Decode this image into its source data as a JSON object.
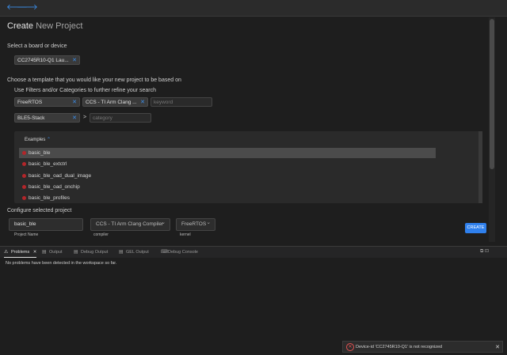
{
  "nav": {
    "back_icon": "arrow-left-icon",
    "forward_icon": "arrow-right-icon",
    "back_glyph": "🡐",
    "forward_glyph": "🡒"
  },
  "page": {
    "title_main": "Create",
    "title_rest": "New Project"
  },
  "board": {
    "section_label": "Select a board or device",
    "selected": "CC2745R10-Q1 Lau...",
    "remove_glyph": "✕"
  },
  "template": {
    "section_label": "Choose a template that you would like your new project to be based on",
    "filter_hint": "Use Filters and/or Categories to further refine your search",
    "filters": [
      "FreeRTOS",
      "CCS - TI Arm Clang ..."
    ],
    "keyword_placeholder": "keyword",
    "category_chip": "BLE5-Stack",
    "breadcrumb_sep": ">",
    "category_placeholder": "category"
  },
  "examples": {
    "header": "Examples",
    "header_caret": "⌃",
    "items": [
      "basic_ble",
      "basic_ble_extctrl",
      "basic_ble_oad_dual_image",
      "basic_ble_oad_onchip",
      "basic_ble_profiles"
    ],
    "selected_index": 0
  },
  "configure": {
    "section_label": "Configure selected project",
    "project_name": "basic_ble",
    "project_name_label": "Project Name",
    "compiler": "CCS - TI Arm Clang Compiler",
    "compiler_label": "compiler",
    "kernel": "FreeRTOS",
    "kernel_label": "kernel",
    "dropdown_glyph": "⌄",
    "create_label": "CREATE"
  },
  "panel": {
    "tabs": [
      {
        "label": "Problems",
        "icon": "warning-icon",
        "glyph": "⚠",
        "active": true
      },
      {
        "label": "Output",
        "icon": "output-icon",
        "glyph": "▤",
        "active": false
      },
      {
        "label": "Debug Output",
        "icon": "debug-icon",
        "glyph": "▤",
        "active": false
      },
      {
        "label": "GEL Output",
        "icon": "output-icon",
        "glyph": "▤",
        "active": false
      },
      {
        "label": "Debug Console",
        "icon": "console-icon",
        "glyph": "⌨",
        "active": false
      }
    ],
    "close_glyph": "✕",
    "message": "No problems have been detected in the workspace so far."
  },
  "toast": {
    "icon": "error-icon",
    "icon_glyph": "✕",
    "message": "Device-id 'CC2745R10-Q1' is not recognized",
    "close_glyph": "✕"
  },
  "colors": {
    "accent": "#2f80ed",
    "error": "#e05252",
    "background": "#1e1e1e"
  }
}
